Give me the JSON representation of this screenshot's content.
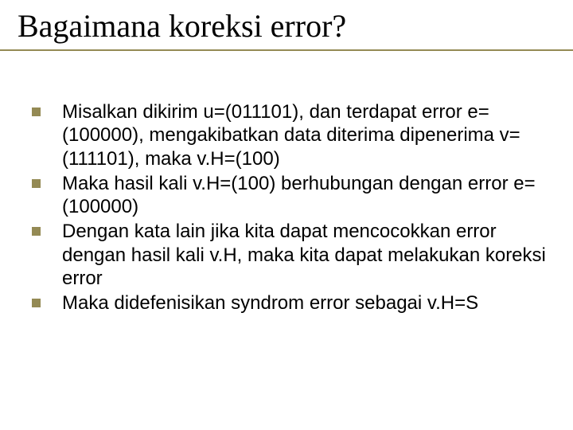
{
  "title": "Bagaimana koreksi error?",
  "bullets": [
    "Misalkan dikirim u=(011101), dan terdapat error e=(100000), mengakibatkan data diterima dipenerima v=(111101), maka v.H=(100)",
    "Maka hasil kali v.H=(100) berhubungan dengan error e=(100000)",
    "Dengan kata lain jika kita dapat mencocokkan error dengan hasil kali v.H, maka kita dapat melakukan koreksi error",
    "Maka didefenisikan syndrom error sebagai v.H=S"
  ]
}
